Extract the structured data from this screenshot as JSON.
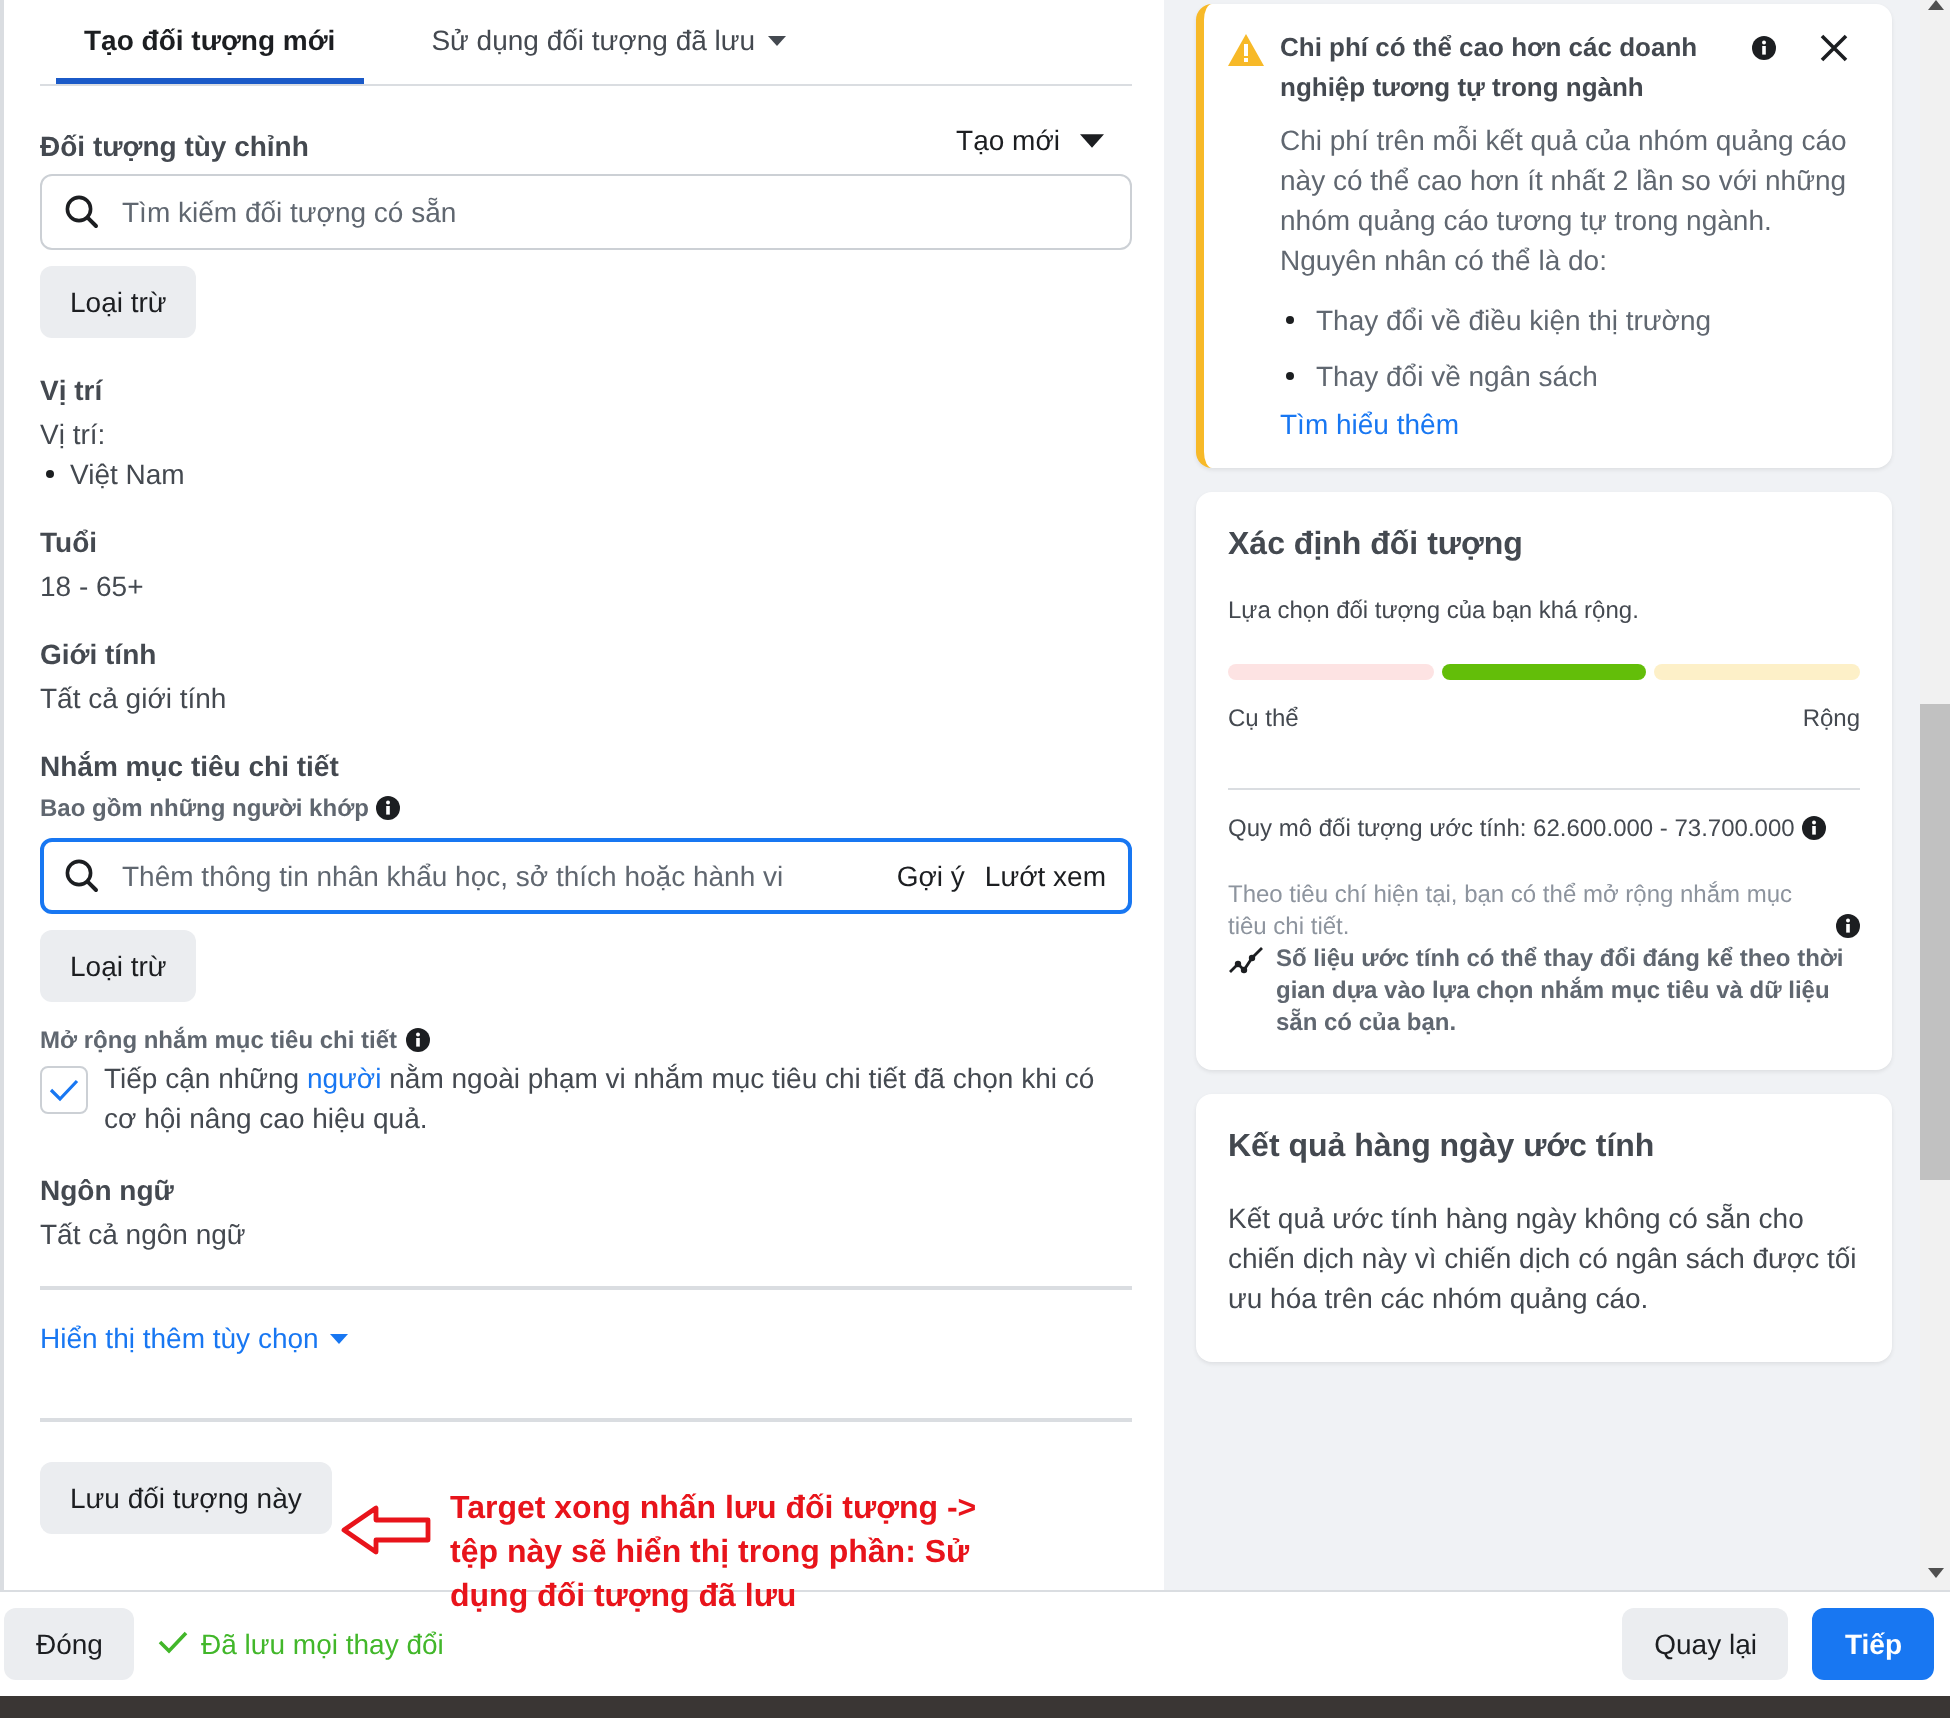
{
  "tabs": [
    {
      "label": "Tạo đối tượng mới",
      "selected": true,
      "dropdown": false
    },
    {
      "label": "Sử dụng đối tượng đã lưu",
      "selected": false,
      "dropdown": true
    }
  ],
  "sections": [
    {
      "kind": "custom",
      "title": "Đối tượng tùy chỉnh",
      "action": "Tạo mới",
      "placeholder": "Tìm kiếm đối tượng có sẵn",
      "exclude_button": "Loại trừ"
    },
    {
      "kind": "list",
      "title": "Vị trí",
      "label": "Vị trí:",
      "items": [
        "Việt Nam"
      ]
    },
    {
      "kind": "value",
      "title": "Tuổi",
      "value": "18 - 65+"
    },
    {
      "kind": "value",
      "title": "Giới tính",
      "value": "Tất cả giới tính"
    },
    {
      "kind": "detailed",
      "title": "Nhắm mục tiêu chi tiết",
      "subtitle": "Bao gồm những người khớp",
      "placeholder": "Thêm thông tin nhân khẩu học, sở thích hoặc hành vi",
      "links": [
        "Gợi ý",
        "Lướt xem"
      ],
      "exclude_button": "Loại trừ",
      "expansion": {
        "title": "Mở rộng nhắm mục tiêu chi tiết",
        "checked": true,
        "text_before": "Tiếp cận những ",
        "link": "người",
        "text_after": " nằm ngoài phạm vi nhắm mục tiêu chi tiết đã chọn khi có cơ hội nâng cao hiệu quả."
      }
    },
    {
      "kind": "value",
      "title": "Ngôn ngữ",
      "value": "Tất cả ngôn ngữ"
    }
  ],
  "more_options": "Hiển thị thêm tùy chọn",
  "save_button": "Lưu đối tượng này",
  "annotation": "Target xong nhấn lưu đối tượng -> tệp này sẽ hiển thị trong phần: Sử dụng đối tượng đã lưu",
  "alert": {
    "title": "Chi phí có thể cao hơn các doanh nghiệp tương tự trong ngành",
    "body": "Chi phí trên mỗi kết quả của nhóm quảng cáo này có thể cao hơn ít nhất 2 lần so với những nhóm quảng cáo tương tự trong ngành. Nguyên nhân có thể là do:",
    "bullets": [
      "Thay đổi về điều kiện thị trường",
      "Thay đổi về ngân sách"
    ],
    "link": "Tìm hiểu thêm"
  },
  "audience_definition": {
    "title": "Xác định đối tượng",
    "summary": "Lựa chọn đối tượng của bạn khá rộng.",
    "segments": [
      {
        "kind": "specific",
        "selected": false
      },
      {
        "kind": "middle",
        "selected": true
      },
      {
        "kind": "broad",
        "selected": false
      }
    ],
    "left_label": "Cụ thể",
    "right_label": "Rộng",
    "size": "Quy mô đối tượng ước tính: 62.600.000 - 73.700.000",
    "hint": "Theo tiêu chí hiện tại, bạn có thể mở rộng nhắm mục tiêu chi tiết.",
    "note": "Số liệu ước tính có thể thay đổi đáng kể theo thời gian dựa vào lựa chọn nhắm mục tiêu và dữ liệu sẵn có của bạn."
  },
  "daily_results": {
    "title": "Kết quả hàng ngày ước tính",
    "body": "Kết quả ước tính hàng ngày không có sẵn cho chiến dịch này vì chiến dịch có ngân sách được tối ưu hóa trên các nhóm quảng cáo."
  },
  "footer": {
    "close_button": "Đóng",
    "status": "Đã lưu mọi thay đổi",
    "back_button": "Quay lại",
    "next_button": "Tiếp"
  }
}
